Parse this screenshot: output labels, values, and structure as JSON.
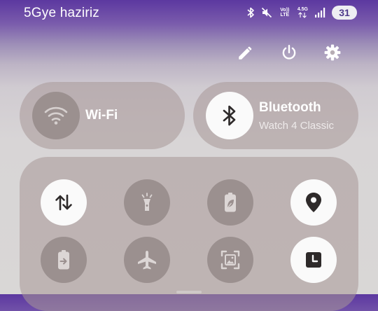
{
  "status_bar": {
    "carrier": "5Gye haziriz",
    "volte_label": "Vo)) LTE",
    "network_label": "4.5G",
    "battery_level": "31"
  },
  "top_actions": [
    {
      "name": "edit",
      "icon": "pencil-icon"
    },
    {
      "name": "power",
      "icon": "power-icon"
    },
    {
      "name": "settings",
      "icon": "gear-icon"
    }
  ],
  "tiles": {
    "wifi": {
      "label": "Wi-Fi",
      "state": "off",
      "icon": "wifi-icon"
    },
    "bluetooth": {
      "label": "Bluetooth",
      "sublabel": "Watch 4 Classic",
      "state": "on",
      "icon": "bluetooth-icon"
    }
  },
  "quick_settings": [
    {
      "name": "mobile-data",
      "icon": "data-arrows-icon",
      "state": "on"
    },
    {
      "name": "flashlight",
      "icon": "flashlight-icon",
      "state": "off"
    },
    {
      "name": "power-saving",
      "icon": "battery-leaf-icon",
      "state": "off"
    },
    {
      "name": "location",
      "icon": "location-pin-icon",
      "state": "on"
    },
    {
      "name": "wireless-powershare",
      "icon": "battery-share-icon",
      "state": "off"
    },
    {
      "name": "airplane-mode",
      "icon": "airplane-icon",
      "state": "off"
    },
    {
      "name": "screenshot",
      "icon": "screen-capture-icon",
      "state": "off"
    },
    {
      "name": "bedtime",
      "icon": "clock-icon",
      "state": "on"
    }
  ],
  "colors": {
    "accent_dark": "#2e2a2a",
    "tile_on": "#fafafa",
    "tile_off": "#9b908f",
    "status_bar": "#5c38a0"
  }
}
